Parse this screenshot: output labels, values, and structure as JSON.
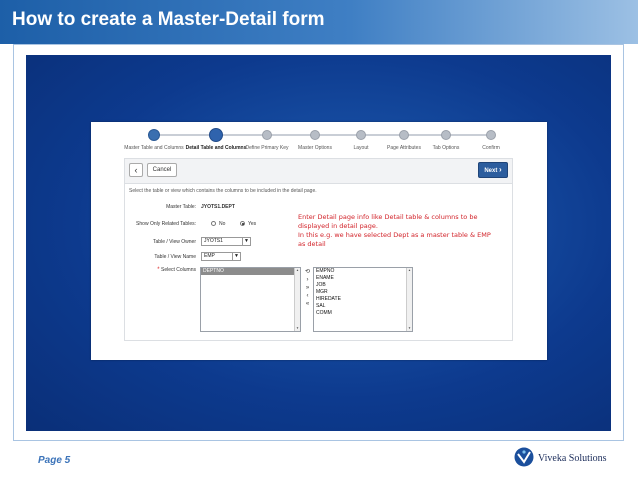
{
  "slide": {
    "title": "How to create a Master-Detail form",
    "page_label": "Page 5",
    "company": "Viveka Solutions"
  },
  "wizard": {
    "steps": [
      {
        "label": "Master Table and Columns",
        "state": "done"
      },
      {
        "label": "Detail Table and Columns",
        "state": "current"
      },
      {
        "label": "Define Primary Key",
        "state": "todo"
      },
      {
        "label": "Master Options",
        "state": "todo"
      },
      {
        "label": "Layout",
        "state": "todo"
      },
      {
        "label": "Page Attributes",
        "state": "todo"
      },
      {
        "label": "Tab Options",
        "state": "todo"
      },
      {
        "label": "Confirm",
        "state": "todo"
      }
    ],
    "back_icon": "chevron-left-icon",
    "cancel_label": "Cancel",
    "next_label": "Next",
    "intro_text": "Select the table or view which contains the columns to be included in the detail page.",
    "master_table_label": "Master Table:",
    "master_table_value": "JYOTS1.DEPT",
    "show_related_label": "Show Only Related Tables:",
    "radio_no": "No",
    "radio_yes": "Yes",
    "radio_selected": "Yes",
    "owner_label": "Table / View Owner",
    "owner_value": "JYOTS1",
    "view_name_label": "Table / View Name",
    "view_name_value": "EMP",
    "required_marker": "*",
    "select_columns_label": "Select Columns",
    "selected_columns": [
      "DEPTNO"
    ],
    "available_columns": [
      "EMPNO",
      "ENAME",
      "JOB",
      "MGR",
      "HIREDATE",
      "SAL",
      "COMM"
    ]
  },
  "annotation": {
    "line1": "Enter Detail page info like Detail table & columns to be displayed in detail page.",
    "line2": "In this e.g. we have selected Dept as a master table & EMP as detail"
  },
  "colors": {
    "header_blue": "#1d5fa8",
    "slide_bg_blue": "#0d3a8e",
    "annotation_red": "#d2232a",
    "next_button": "#2c5d9e"
  }
}
